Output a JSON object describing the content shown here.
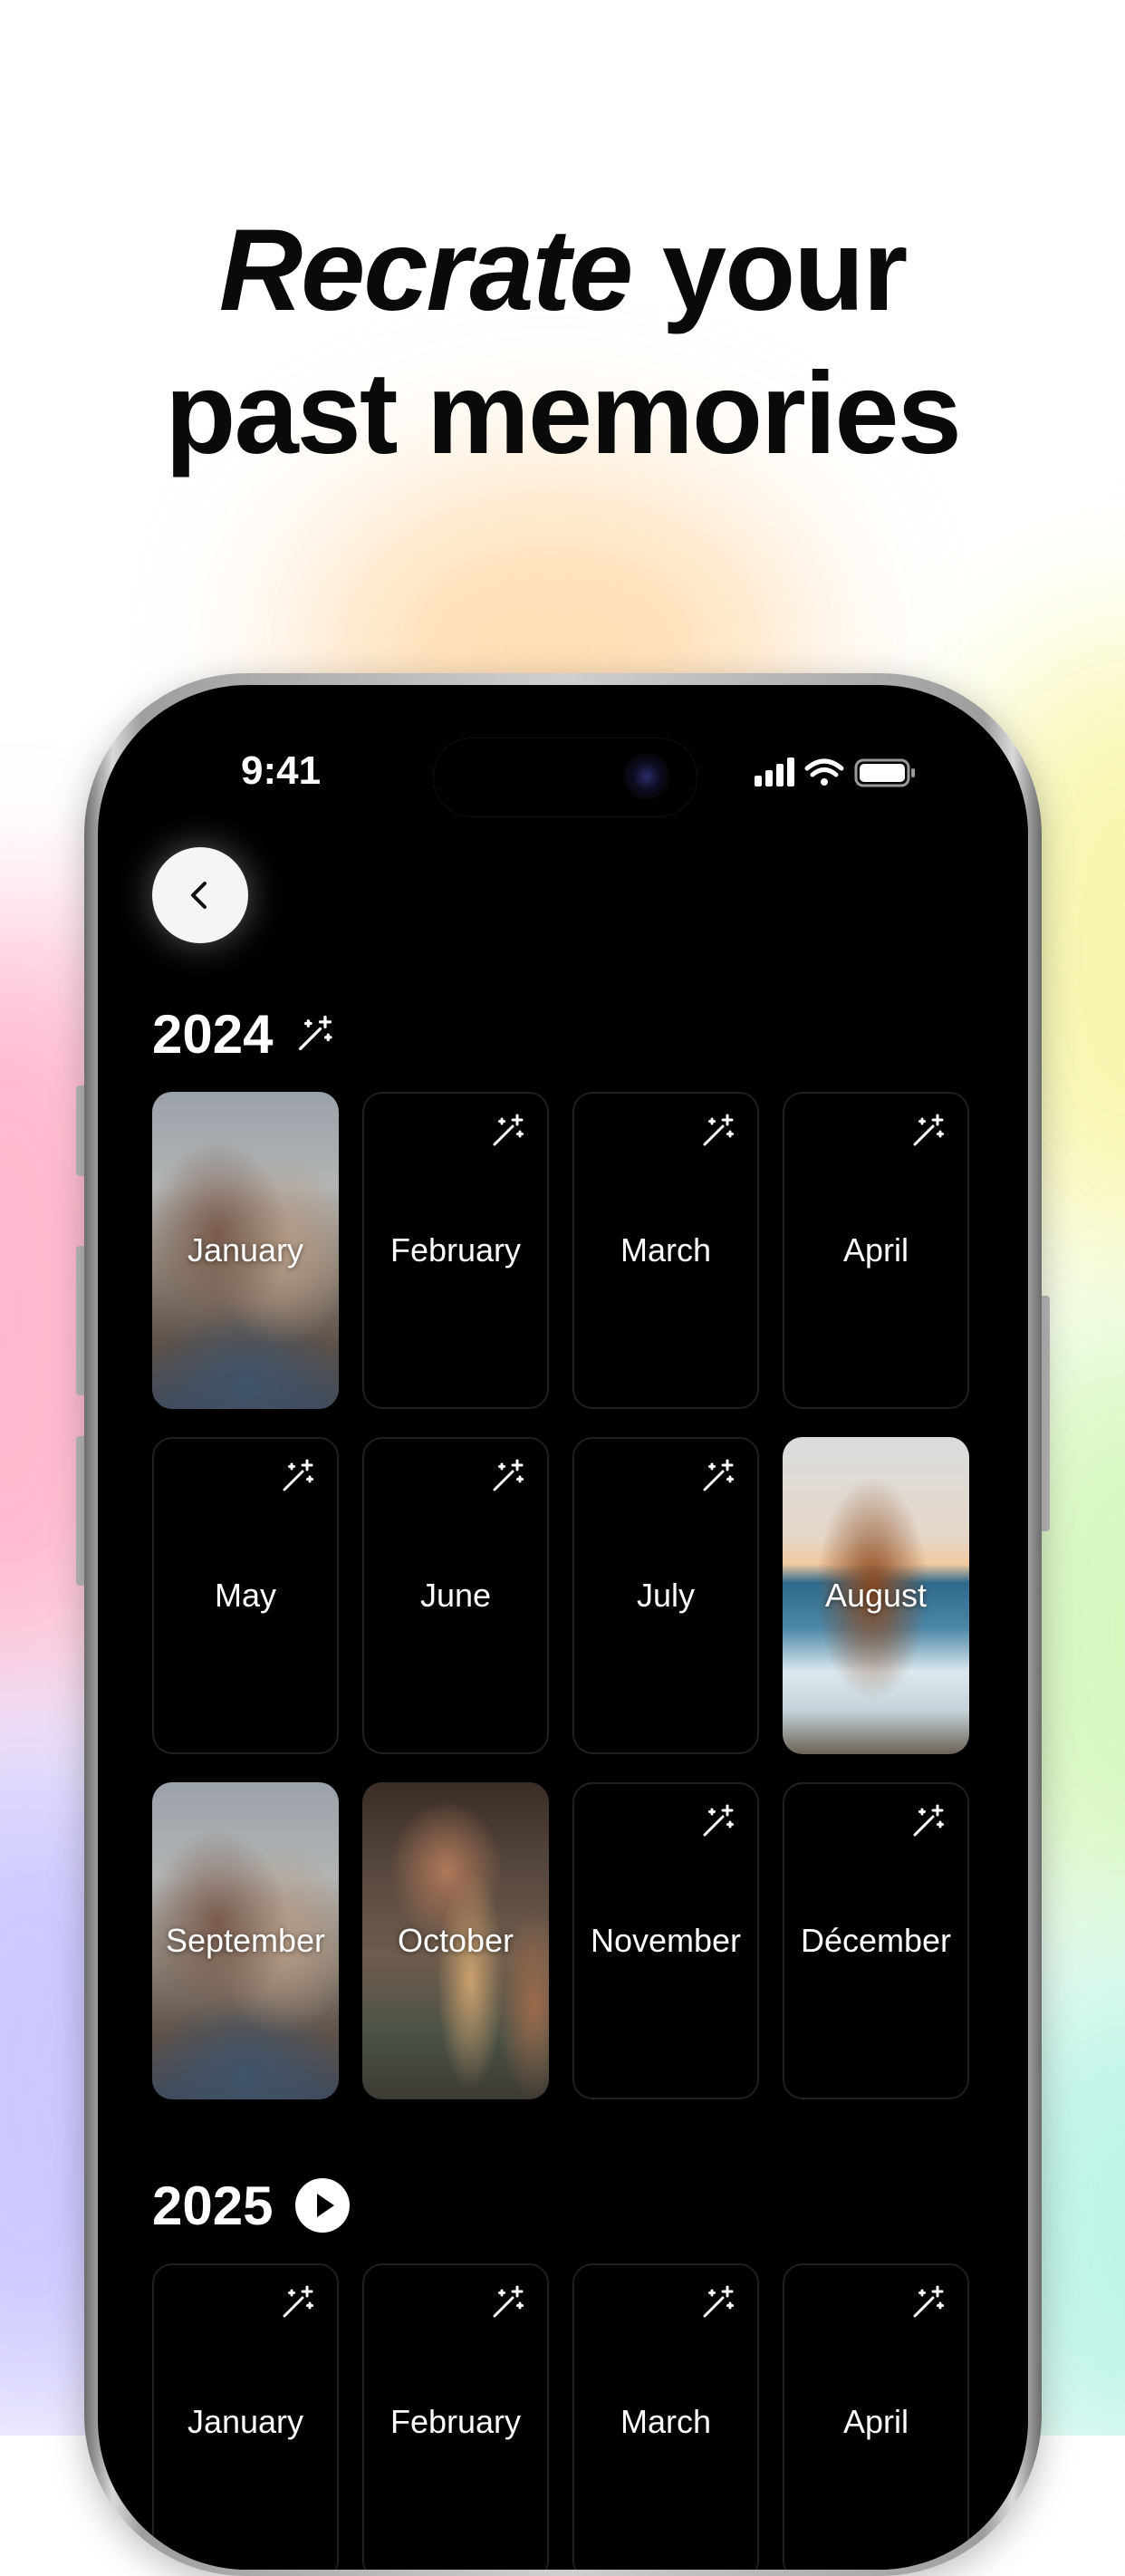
{
  "headline": {
    "italic_word": "Recrate",
    "line1_rest": " your",
    "line2": "past memories"
  },
  "status_bar": {
    "time": "9:41",
    "icons": [
      "cellular-signal-icon",
      "wifi-icon",
      "battery-icon"
    ]
  },
  "nav": {
    "back_icon": "chevron-left-icon"
  },
  "years": [
    {
      "year": "2024",
      "badge_icon": "magic-wand-icon",
      "months": [
        {
          "label": "January",
          "has_photo": true,
          "photo": "friends-selfie"
        },
        {
          "label": "February",
          "has_photo": false
        },
        {
          "label": "March",
          "has_photo": false
        },
        {
          "label": "April",
          "has_photo": false
        },
        {
          "label": "May",
          "has_photo": false
        },
        {
          "label": "June",
          "has_photo": false
        },
        {
          "label": "July",
          "has_photo": false
        },
        {
          "label": "August",
          "has_photo": true,
          "photo": "dog-on-beach"
        },
        {
          "label": "September",
          "has_photo": true,
          "photo": "friends-selfie"
        },
        {
          "label": "October",
          "has_photo": true,
          "photo": "friends-jenga"
        },
        {
          "label": "November",
          "has_photo": false
        },
        {
          "label": "Décember",
          "has_photo": false
        }
      ]
    },
    {
      "year": "2025",
      "badge_icon": "play-circle-icon",
      "months": [
        {
          "label": "January",
          "has_photo": false
        },
        {
          "label": "February",
          "has_photo": false
        },
        {
          "label": "March",
          "has_photo": false
        },
        {
          "label": "April",
          "has_photo": false
        }
      ]
    }
  ],
  "colors": {
    "screen_bg": "#000000",
    "card_border": "#1f1f1f",
    "text_primary": "#ffffff",
    "headline": "#0a0a0a"
  }
}
